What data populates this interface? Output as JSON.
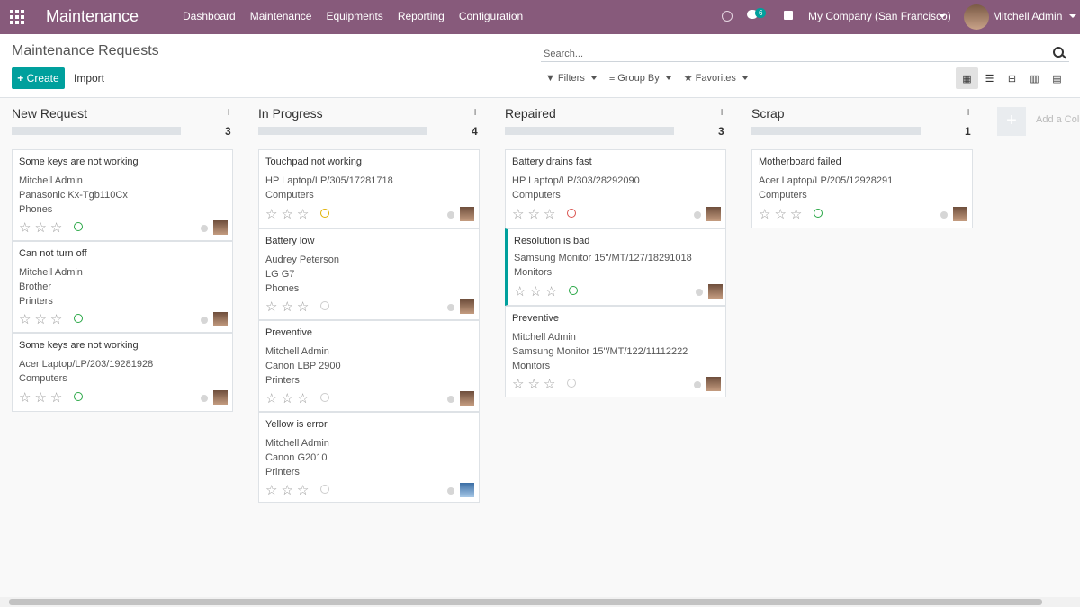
{
  "navbar": {
    "brand": "Maintenance",
    "menu": [
      "Dashboard",
      "Maintenance",
      "Equipments",
      "Reporting",
      "Configuration"
    ],
    "chat_badge": "6",
    "company": "My Company (San Francisco)",
    "user": "Mitchell Admin"
  },
  "control_panel": {
    "title": "Maintenance Requests",
    "create_label": "Create",
    "import_label": "Import",
    "search_placeholder": "Search...",
    "filters_label": "Filters",
    "groupby_label": "Group By",
    "favorites_label": "Favorites"
  },
  "columns": [
    {
      "title": "New Request",
      "count": "3",
      "cards": [
        {
          "title": "Some keys are not working",
          "lines": [
            "Mitchell Admin",
            "Panasonic Kx-Tgb110Cx",
            "Phones"
          ],
          "status": "green"
        },
        {
          "title": "Can not turn off",
          "lines": [
            "Mitchell Admin",
            "Brother",
            "Printers"
          ],
          "status": "green"
        },
        {
          "title": "Some keys are not working",
          "lines": [
            "Acer Laptop/LP/203/19281928",
            "Computers"
          ],
          "status": "green"
        }
      ]
    },
    {
      "title": "In Progress",
      "count": "4",
      "cards": [
        {
          "title": "Touchpad not working",
          "lines": [
            "HP Laptop/LP/305/17281718",
            "Computers"
          ],
          "status": "yellow"
        },
        {
          "title": "Battery low",
          "lines": [
            "Audrey Peterson",
            "LG G7",
            "Phones"
          ],
          "status": "none"
        },
        {
          "title": "Preventive",
          "lines": [
            "Mitchell Admin",
            "Canon LBP 2900",
            "Printers"
          ],
          "status": "none"
        },
        {
          "title": "Yellow is error",
          "lines": [
            "Mitchell Admin",
            "Canon G2010",
            "Printers"
          ],
          "status": "none"
        }
      ]
    },
    {
      "title": "Repaired",
      "count": "3",
      "cards": [
        {
          "title": "Battery drains fast",
          "lines": [
            "HP Laptop/LP/303/28292090",
            "Computers"
          ],
          "status": "red"
        },
        {
          "title": "Resolution is bad",
          "lines": [
            "Samsung Monitor 15\"/MT/127/18291018",
            "Monitors"
          ],
          "status": "green"
        },
        {
          "title": "Preventive",
          "lines": [
            "Mitchell Admin",
            "Samsung Monitor 15\"/MT/122/11112222",
            "Monitors"
          ],
          "status": "none"
        }
      ]
    },
    {
      "title": "Scrap",
      "count": "1",
      "cards": [
        {
          "title": "Motherboard failed",
          "lines": [
            "Acer Laptop/LP/205/12928291",
            "Computers"
          ],
          "status": "green"
        }
      ]
    }
  ],
  "add_column_label": "Add a Colu",
  "colors": {
    "brand": "#875a7b",
    "primary": "#00a09d",
    "green": "#28a745",
    "yellow": "#e0b000",
    "red": "#d9534f"
  }
}
